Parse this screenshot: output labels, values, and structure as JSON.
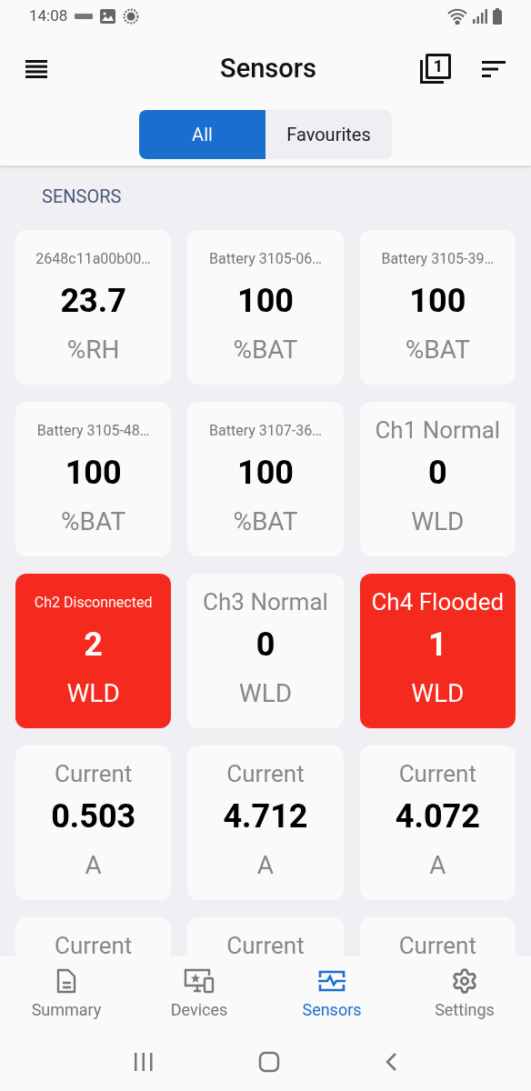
{
  "status_bar": {
    "time": "14:08"
  },
  "header": {
    "title": "Sensors",
    "badge": "1"
  },
  "filter_tabs": [
    {
      "label": "All",
      "selected": true
    },
    {
      "label": "Favourites",
      "selected": false
    }
  ],
  "section_title": "SENSORS",
  "cards": [
    {
      "title": "2648c11a00b00…",
      "kind": "compact",
      "value": "23.7",
      "unit": "%RH",
      "alert": false
    },
    {
      "title": "Battery 3105-06…",
      "kind": "compact",
      "value": "100",
      "unit": "%BAT",
      "alert": false
    },
    {
      "title": "Battery 3105-39…",
      "kind": "compact",
      "value": "100",
      "unit": "%BAT",
      "alert": false
    },
    {
      "title": "Battery 3105-48…",
      "kind": "compact",
      "value": "100",
      "unit": "%BAT",
      "alert": false
    },
    {
      "title": "Battery 3107-36…",
      "kind": "compact",
      "value": "100",
      "unit": "%BAT",
      "alert": false
    },
    {
      "title": "Ch1 Normal",
      "kind": "regular",
      "value": "0",
      "unit": "WLD",
      "alert": false
    },
    {
      "title": "Ch2 Disconnected",
      "kind": "compact",
      "value": "2",
      "unit": "WLD",
      "alert": true
    },
    {
      "title": "Ch3 Normal",
      "kind": "regular",
      "value": "0",
      "unit": "WLD",
      "alert": false
    },
    {
      "title": "Ch4 Flooded",
      "kind": "regular",
      "value": "1",
      "unit": "WLD",
      "alert": true
    },
    {
      "title": "Current",
      "kind": "regular",
      "value": "0.503",
      "unit": "A",
      "alert": false
    },
    {
      "title": "Current",
      "kind": "regular",
      "value": "4.712",
      "unit": "A",
      "alert": false
    },
    {
      "title": "Current",
      "kind": "regular",
      "value": "4.072",
      "unit": "A",
      "alert": false
    },
    {
      "title": "Current",
      "kind": "regular",
      "alert": false
    },
    {
      "title": "Current",
      "kind": "regular",
      "alert": false
    },
    {
      "title": "Current",
      "kind": "regular",
      "alert": false
    }
  ],
  "bottom_nav": [
    {
      "label": "Summary",
      "kind": "summary",
      "selected": false
    },
    {
      "label": "Devices",
      "kind": "devices",
      "selected": false
    },
    {
      "label": "Sensors",
      "kind": "sensors",
      "selected": true
    },
    {
      "label": "Settings",
      "kind": "settings",
      "selected": false
    }
  ]
}
